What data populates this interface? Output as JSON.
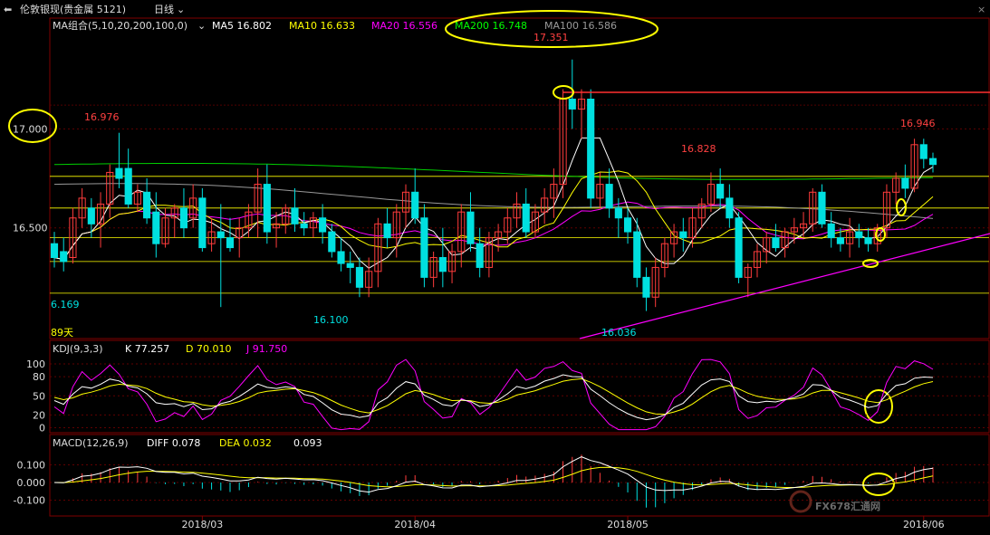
{
  "window": {
    "title": "伦敦银现(贵金属 5121)",
    "period": "日线"
  },
  "colors": {
    "bg": "#000000",
    "up": "#ff3c3c",
    "down": "#00e0e0",
    "ma5": "#ffffff",
    "ma10": "#ffff00",
    "ma20": "#ff00ff",
    "ma200": "#00d000",
    "ma100": "#999999",
    "grid": "#800000",
    "annot": "#ffff00",
    "trend": "#ff00ff",
    "hline": "#ff3030"
  },
  "main_legend": {
    "ma_label": "MA组合(5,10,20,200,100,0)",
    "ma5": "MA5 16.802",
    "ma10": "MA10 16.633",
    "ma20": "MA20 16.556",
    "ma200": "MA200 16.748",
    "ma100": "MA100 16.586"
  },
  "kdj_legend": {
    "label": "KDJ(9,3,3)",
    "k": "K 77.257",
    "d": "D 70.010",
    "j": "J 91.750"
  },
  "macd_legend": {
    "label": "MACD(12,26,9)",
    "diff": "DIFF 0.078",
    "dea": "DEA 0.032",
    "macd": "0.093"
  },
  "annotations": {
    "high": "17.351",
    "hi1": "16.976",
    "hi2": "16.828",
    "hi3": "16.946",
    "lo1": "16.100",
    "lo2": "16.036",
    "leftlow": "6.169",
    "days": "89天"
  },
  "watermark": "FX678汇通网",
  "chart_data": [
    {
      "type": "candlestick",
      "x_ticks": [
        "2018/03",
        "2018/04",
        "2018/05",
        "2018/06"
      ],
      "y_ticks": [
        "17.000",
        "16.500"
      ],
      "ylim": [
        15.95,
        17.55
      ],
      "horizontal_lines": [
        17.12,
        16.76,
        16.6,
        16.45,
        16.33,
        16.17
      ],
      "candles": [
        [
          16.42,
          16.48,
          16.3,
          16.35
        ],
        [
          16.38,
          16.45,
          16.28,
          16.33
        ],
        [
          16.35,
          16.6,
          16.32,
          16.55
        ],
        [
          16.55,
          16.7,
          16.5,
          16.65
        ],
        [
          16.6,
          16.65,
          16.45,
          16.52
        ],
        [
          16.52,
          16.68,
          16.4,
          16.62
        ],
        [
          16.62,
          16.82,
          16.55,
          16.78
        ],
        [
          16.8,
          16.98,
          16.7,
          16.75
        ],
        [
          16.8,
          16.9,
          16.6,
          16.62
        ],
        [
          16.62,
          16.72,
          16.58,
          16.68
        ],
        [
          16.68,
          16.75,
          16.52,
          16.55
        ],
        [
          16.58,
          16.68,
          16.35,
          16.42
        ],
        [
          16.42,
          16.6,
          16.4,
          16.55
        ],
        [
          16.55,
          16.62,
          16.45,
          16.6
        ],
        [
          16.6,
          16.7,
          16.45,
          16.5
        ],
        [
          16.55,
          16.72,
          16.5,
          16.65
        ],
        [
          16.65,
          16.7,
          16.38,
          16.4
        ],
        [
          16.42,
          16.55,
          16.38,
          16.48
        ],
        [
          16.48,
          16.62,
          16.1,
          16.45
        ],
        [
          16.45,
          16.55,
          16.38,
          16.4
        ],
        [
          16.45,
          16.55,
          16.35,
          16.5
        ],
        [
          16.5,
          16.62,
          16.45,
          16.58
        ],
        [
          16.58,
          16.8,
          16.45,
          16.72
        ],
        [
          16.72,
          16.82,
          16.42,
          16.48
        ],
        [
          16.5,
          16.58,
          16.4,
          16.52
        ],
        [
          16.52,
          16.62,
          16.47,
          16.6
        ],
        [
          16.6,
          16.7,
          16.48,
          16.52
        ],
        [
          16.52,
          16.58,
          16.46,
          16.5
        ],
        [
          16.5,
          16.58,
          16.45,
          16.55
        ],
        [
          16.55,
          16.62,
          16.42,
          16.48
        ],
        [
          16.48,
          16.52,
          16.35,
          16.38
        ],
        [
          16.38,
          16.45,
          16.28,
          16.32
        ],
        [
          16.32,
          16.38,
          16.22,
          16.3
        ],
        [
          16.3,
          16.35,
          16.15,
          16.2
        ],
        [
          16.2,
          16.35,
          16.15,
          16.28
        ],
        [
          16.28,
          16.55,
          16.2,
          16.52
        ],
        [
          16.52,
          16.6,
          16.4,
          16.45
        ],
        [
          16.45,
          16.62,
          16.35,
          16.58
        ],
        [
          16.58,
          16.72,
          16.5,
          16.68
        ],
        [
          16.68,
          16.8,
          16.52,
          16.55
        ],
        [
          16.55,
          16.62,
          16.2,
          16.25
        ],
        [
          16.25,
          16.38,
          16.2,
          16.35
        ],
        [
          16.35,
          16.5,
          16.2,
          16.28
        ],
        [
          16.28,
          16.42,
          16.22,
          16.38
        ],
        [
          16.38,
          16.62,
          16.3,
          16.58
        ],
        [
          16.58,
          16.68,
          16.38,
          16.42
        ],
        [
          16.42,
          16.5,
          16.25,
          16.3
        ],
        [
          16.3,
          16.48,
          16.25,
          16.45
        ],
        [
          16.45,
          16.52,
          16.38,
          16.48
        ],
        [
          16.48,
          16.6,
          16.42,
          16.55
        ],
        [
          16.55,
          16.68,
          16.5,
          16.62
        ],
        [
          16.62,
          16.7,
          16.45,
          16.48
        ],
        [
          16.48,
          16.62,
          16.45,
          16.58
        ],
        [
          16.58,
          16.7,
          16.52,
          16.65
        ],
        [
          16.65,
          16.8,
          16.55,
          16.72
        ],
        [
          16.72,
          17.2,
          16.65,
          17.15
        ],
        [
          17.15,
          17.35,
          17.0,
          17.1
        ],
        [
          17.1,
          17.2,
          16.95,
          17.15
        ],
        [
          17.15,
          17.2,
          16.6,
          16.65
        ],
        [
          16.65,
          16.78,
          16.6,
          16.72
        ],
        [
          16.72,
          16.8,
          16.55,
          16.6
        ],
        [
          16.6,
          16.65,
          16.45,
          16.55
        ],
        [
          16.55,
          16.6,
          16.42,
          16.48
        ],
        [
          16.48,
          16.55,
          16.2,
          16.25
        ],
        [
          16.25,
          16.3,
          16.08,
          16.15
        ],
        [
          16.15,
          16.35,
          16.1,
          16.3
        ],
        [
          16.3,
          16.45,
          16.25,
          16.42
        ],
        [
          16.42,
          16.52,
          16.35,
          16.48
        ],
        [
          16.48,
          16.55,
          16.38,
          16.45
        ],
        [
          16.45,
          16.6,
          16.4,
          16.55
        ],
        [
          16.55,
          16.65,
          16.5,
          16.62
        ],
        [
          16.62,
          16.78,
          16.58,
          16.72
        ],
        [
          16.72,
          16.8,
          16.6,
          16.65
        ],
        [
          16.65,
          16.72,
          16.5,
          16.55
        ],
        [
          16.55,
          16.58,
          16.22,
          16.25
        ],
        [
          16.25,
          16.32,
          16.15,
          16.3
        ],
        [
          16.3,
          16.42,
          16.25,
          16.38
        ],
        [
          16.38,
          16.48,
          16.32,
          16.45
        ],
        [
          16.45,
          16.52,
          16.38,
          16.4
        ],
        [
          16.4,
          16.5,
          16.35,
          16.48
        ],
        [
          16.48,
          16.55,
          16.42,
          16.5
        ],
        [
          16.5,
          16.58,
          16.45,
          16.52
        ],
        [
          16.52,
          16.7,
          16.48,
          16.68
        ],
        [
          16.68,
          16.72,
          16.5,
          16.52
        ],
        [
          16.52,
          16.58,
          16.4,
          16.45
        ],
        [
          16.45,
          16.5,
          16.38,
          16.42
        ],
        [
          16.42,
          16.55,
          16.35,
          16.48
        ],
        [
          16.48,
          16.52,
          16.4,
          16.45
        ],
        [
          16.45,
          16.5,
          16.38,
          16.42
        ],
        [
          16.42,
          16.52,
          16.38,
          16.5
        ],
        [
          16.5,
          16.72,
          16.45,
          16.68
        ],
        [
          16.68,
          16.78,
          16.62,
          16.75
        ],
        [
          16.75,
          16.82,
          16.65,
          16.7
        ],
        [
          16.7,
          16.95,
          16.68,
          16.92
        ],
        [
          16.92,
          16.95,
          16.8,
          16.85
        ],
        [
          16.85,
          16.88,
          16.78,
          16.82
        ]
      ]
    },
    {
      "type": "line",
      "name": "KDJ(9,3,3)",
      "y_ticks": [
        100,
        80,
        50,
        20,
        0
      ],
      "ylim": [
        -5,
        110
      ]
    },
    {
      "type": "bar",
      "name": "MACD(12,26,9)",
      "y_ticks": [
        "0.100",
        "0.000",
        "-0.100"
      ],
      "ylim": [
        -0.18,
        0.18
      ]
    }
  ]
}
